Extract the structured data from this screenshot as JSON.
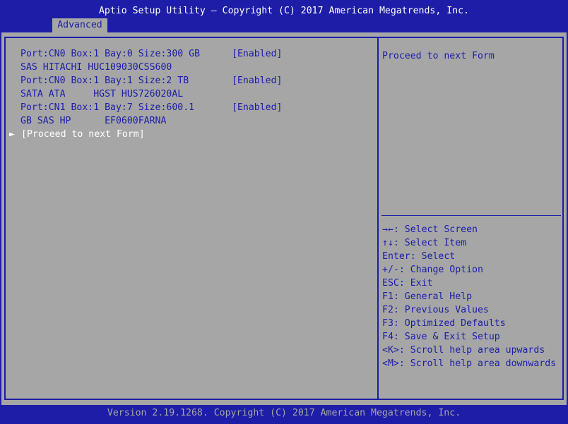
{
  "header": {
    "title": "Aptio Setup Utility – Copyright (C) 2017 American Megatrends, Inc.",
    "tab": "Advanced"
  },
  "entries": [
    {
      "label": "Port:CN0 Box:1 Bay:0 Size:300 GB",
      "value": "[Enabled]",
      "model": "SAS HITACHI HUC109030CSS600"
    },
    {
      "label": "Port:CN0 Box:1 Bay:1 Size:2 TB",
      "value": "[Enabled]",
      "model": "SATA ATA     HGST HUS726020AL"
    },
    {
      "label": "Port:CN1 Box:1 Bay:7 Size:600.1",
      "value": "[Enabled]",
      "model": "GB SAS HP      EF0600FARNA"
    }
  ],
  "proceed": {
    "arrow": "►",
    "label": "[Proceed to next Form]"
  },
  "help": {
    "text": "Proceed to next Form",
    "keys": [
      "→←: Select Screen",
      "↑↓: Select Item",
      "Enter: Select",
      "+/-: Change Option",
      "ESC: Exit",
      "F1: General Help",
      "F2: Previous Values",
      "F3: Optimized Defaults",
      "F4: Save & Exit Setup",
      "<K>: Scroll help area upwards",
      "<M>: Scroll help area downwards"
    ]
  },
  "footer": "Version 2.19.1268. Copyright (C) 2017 American Megatrends, Inc."
}
